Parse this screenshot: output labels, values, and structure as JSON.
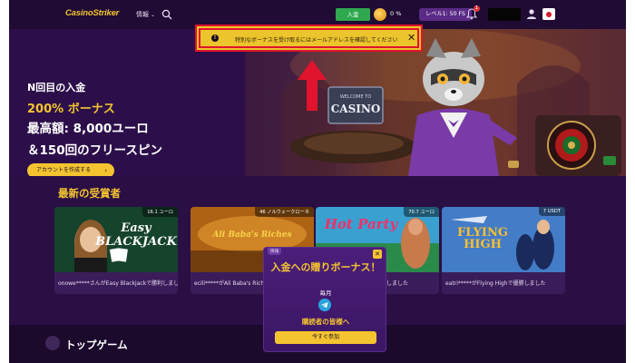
{
  "header": {
    "logo": "CasinoStriker",
    "nav_info": "情報",
    "deposit_label": "入金",
    "progress_pct": "0 %",
    "level_label": "レベル1: 50 FS",
    "notification_count": "1"
  },
  "notice": {
    "message": "特別なボーナスを受け取るにはメールアドレスを確認してください",
    "close": "✕"
  },
  "hero": {
    "line1": "N回目の入金",
    "bonus": "200% ボーナス",
    "max": "最高額: 8,000ユーロ",
    "spins": "＆150回のフリースピン",
    "cta": "アカウントを作成する",
    "sign_text": "WELCOME TO",
    "sign_casino": "CASINO"
  },
  "winners": {
    "title": "最新の受賞者",
    "cards": [
      {
        "amount": "16.1 ユーロ",
        "game": "Easy BLACKJACK",
        "text": "onowe*****さんがEasy Blackjackで勝利しました"
      },
      {
        "amount": "46 ノルウェークローネ",
        "game": "Ali Baba's Riches",
        "text": "ecili*****がAli Baba's Riches"
      },
      {
        "amount": "70.7 ユーロ",
        "game": "Hot Party",
        "text": "で優勝しました"
      },
      {
        "amount": "7 USDT",
        "game": "FLYING HIGH",
        "text": "eatri*****がFlying Highで優勝しました"
      }
    ]
  },
  "popup": {
    "tag": "情報",
    "title": "入金への贈りボーナス！",
    "sub": "毎月",
    "readers": "購読者の皆様へ",
    "join": "今すぐ参加",
    "close": "✕"
  },
  "top_games": {
    "title": "トップゲーム"
  },
  "colors": {
    "accent": "#f4c430",
    "bg": "#2a0f45",
    "highlight": "#e1132d"
  }
}
